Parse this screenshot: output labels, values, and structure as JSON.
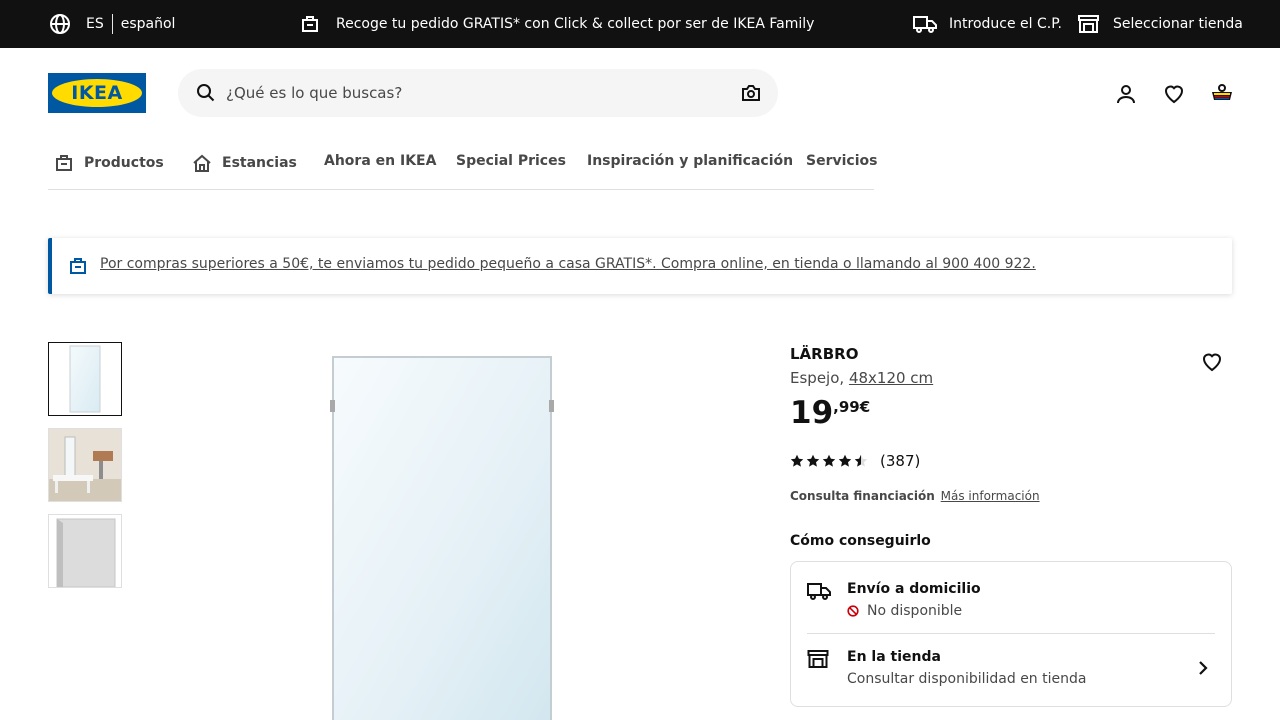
{
  "topbar": {
    "lang_code": "ES",
    "lang_name": "español",
    "promo": "Recoge tu pedido GRATIS* con Click & collect por ser de IKEA Family",
    "zip": "Introduce el C.P.",
    "store": "Seleccionar tienda"
  },
  "header": {
    "logo": "IKEA",
    "search_placeholder": "¿Qué es lo que buscas?"
  },
  "nav": {
    "products": "Productos",
    "rooms": "Estancias",
    "now": "Ahora en IKEA",
    "special": "Special Prices",
    "inspiration": "Inspiración y planificación",
    "services": "Servicios"
  },
  "banner": {
    "text": "Por compras superiores a 50€, te enviamos tu pedido pequeño a casa GRATIS*. Compra online, en tienda o llamando al 900 400 922."
  },
  "product": {
    "name": "LÄRBRO",
    "desc_prefix": "Espejo,",
    "size": "48x120 cm",
    "price_int": "19",
    "price_dec": ",99€",
    "rating": 4.5,
    "review_count": "(387)",
    "finance_label": "Consulta financiación",
    "finance_link": "Más información",
    "how_title": "Cómo conseguirlo"
  },
  "availability": {
    "delivery_title": "Envío a domicilio",
    "delivery_status": "No disponible",
    "store_title": "En la tienda",
    "store_status": "Consultar disponibilidad en tienda"
  },
  "icons": {
    "globe": "globe-icon",
    "promo": "store-bag-icon",
    "truck": "truck-icon",
    "store": "store-icon",
    "search": "search-icon",
    "camera": "camera-icon",
    "profile": "person-icon",
    "heart": "heart-icon",
    "basket": "basket-icon",
    "chevron": "chevron-right-icon"
  },
  "colors": {
    "brand_blue": "#0058a3",
    "brand_yellow": "#ffdb00",
    "topbar_bg": "#111111",
    "unavailable": "#cc0008"
  }
}
